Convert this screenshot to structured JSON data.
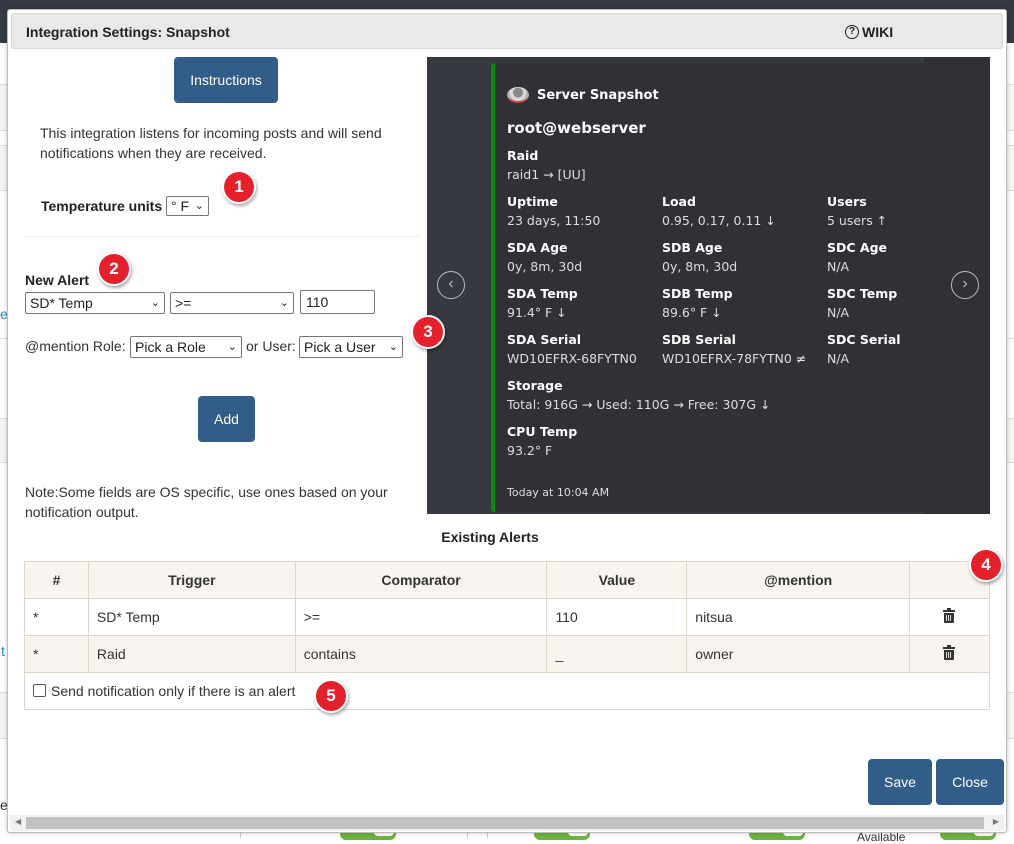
{
  "background": {
    "link_fragments": [
      "e",
      "t",
      "er"
    ],
    "available_text": "Available"
  },
  "modal": {
    "title": "Integration Settings: Snapshot",
    "wiki_label": "WIKI",
    "wiki_icon": "question-circle-icon",
    "instructions_button": "Instructions",
    "description": "This integration listens for incoming posts and will send notifications when they are received.",
    "temperature": {
      "label": "Temperature units",
      "selected": "° F"
    },
    "new_alert": {
      "label": "New Alert",
      "trigger_selected": "SD* Temp",
      "comparator_selected": ">=",
      "value": "110",
      "mention_role_label": "@mention Role:",
      "role_selected": "Pick a Role",
      "or_user_label": "or User:",
      "user_selected": "Pick a User",
      "add_button": "Add"
    },
    "note": "Note:Some fields are OS specific, use ones based on your notification output.",
    "existing_alerts": {
      "title": "Existing Alerts",
      "columns": [
        "#",
        "Trigger",
        "Comparator",
        "Value",
        "@mention",
        ""
      ],
      "rows": [
        {
          "num": "*",
          "trigger": "SD* Temp",
          "comparator": ">=",
          "value": "110",
          "mention": "nitsua"
        },
        {
          "num": "*",
          "trigger": "Raid",
          "comparator": "contains",
          "value": "_",
          "mention": "owner"
        }
      ],
      "checkbox_label": "Send notification only if there is an alert",
      "checkbox_checked": false
    },
    "save_button": "Save",
    "close_button": "Close"
  },
  "badges": [
    "1",
    "2",
    "3",
    "4",
    "5"
  ],
  "preview": {
    "author": "Server Snapshot",
    "title": "root@webserver",
    "fields": [
      {
        "name": "Raid",
        "value": "raid1 → [UU]"
      },
      {
        "name": "Uptime",
        "value": "23 days, 11:50"
      },
      {
        "name": "Load",
        "value": "0.95, 0.17, 0.11 ↓"
      },
      {
        "name": "Users",
        "value": "5 users ↑"
      },
      {
        "name": "SDA Age",
        "value": "0y, 8m, 30d"
      },
      {
        "name": "SDB Age",
        "value": "0y, 8m, 30d"
      },
      {
        "name": "SDC Age",
        "value": "N/A"
      },
      {
        "name": "SDA Temp",
        "value": "91.4° F ↓"
      },
      {
        "name": "SDB Temp",
        "value": "89.6° F ↓"
      },
      {
        "name": "SDC Temp",
        "value": "N/A"
      },
      {
        "name": "SDA Serial",
        "value": "WD10EFRX-68FYTN0"
      },
      {
        "name": "SDB Serial",
        "value": "WD10EFRX-78FYTN0 ≠"
      },
      {
        "name": "SDC Serial",
        "value": "N/A"
      },
      {
        "name": "Storage",
        "value": "Total: 916G → Used: 110G → Free: 307G ↓"
      },
      {
        "name": "CPU Temp",
        "value": "93.2° F"
      }
    ],
    "footer": "Today at 10:04 AM",
    "accent_color": "#0b8a0b"
  },
  "colors": {
    "primary_button": "#325d88",
    "badge": "#e3202b",
    "table_header_bg": "#f8f5f0"
  }
}
